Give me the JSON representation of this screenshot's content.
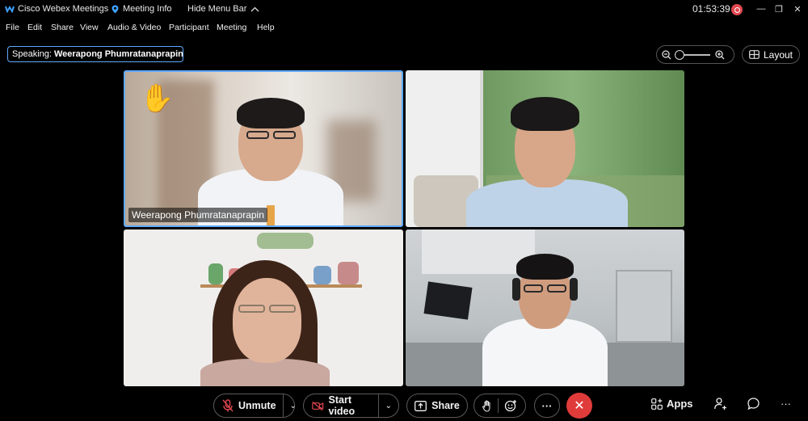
{
  "titlebar": {
    "app_title": "Cisco Webex Meetings",
    "meeting_info": "Meeting Info",
    "hide_menu": "Hide Menu Bar",
    "clock": "01:53:39"
  },
  "menu": [
    "File",
    "Edit",
    "Share",
    "View",
    "Audio & Video",
    "Participant",
    "Meeting",
    "Help"
  ],
  "speaking": {
    "prefix": "Speaking:",
    "name": "Weerapong Phumratanaprapin"
  },
  "layout_label": "Layout",
  "tiles": [
    {
      "label": "Weerapong Phumratanaprapin",
      "hand_raised": true
    }
  ],
  "controls": {
    "unmute": "Unmute",
    "start_video": "Start video",
    "share": "Share",
    "apps": "Apps",
    "more": "···"
  },
  "colors": {
    "accent": "#5fa8ff",
    "end_call": "#e03b3b",
    "record": "#e0474f"
  }
}
